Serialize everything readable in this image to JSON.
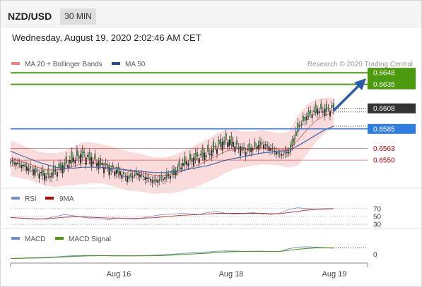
{
  "header": {
    "symbol": "NZD/USD",
    "interval": "30 MIN"
  },
  "datetime": "Wednesday, August 19, 2020 2:02:46 AM CET",
  "colors": {
    "bollinger": "#f08080",
    "ma50": "#1f4e8c",
    "resistance": "#4c9a0e",
    "pivot": "#2f7de1",
    "support": "#cc0000",
    "last": "#333333",
    "rsi": "#6f8fd6",
    "rsi_ma": "#cc0000",
    "macd": "#6f8fd6",
    "macd_signal": "#4c9a0e"
  },
  "chart_data": {
    "type": "candlestick",
    "title": "NZD/USD",
    "subtitle": "Wednesday, August 19, 2020 2:02:46 AM CET",
    "legend": [
      "MA 20 + Bollinger Bands",
      "MA 50"
    ],
    "copyright": "Research © 2020 Trading Central",
    "x_ticks": [
      "Aug 16",
      "Aug 18",
      "Aug 19"
    ],
    "levels": [
      {
        "label": "0.6648",
        "value": 0.6648,
        "kind": "resistance"
      },
      {
        "label": "0.6635",
        "value": 0.6635,
        "kind": "resistance"
      },
      {
        "label": "0.6608",
        "value": 0.6608,
        "kind": "last"
      },
      {
        "label": "0.6585",
        "value": 0.6585,
        "kind": "pivot"
      },
      {
        "label": "0.6563",
        "value": 0.6563,
        "kind": "support"
      },
      {
        "label": "0.6550",
        "value": 0.655,
        "kind": "support"
      }
    ],
    "price": [
      0.6548,
      0.6545,
      0.654,
      0.6536,
      0.6532,
      0.6538,
      0.6545,
      0.6552,
      0.6556,
      0.655,
      0.6545,
      0.654,
      0.6536,
      0.653,
      0.6535,
      0.653,
      0.6526,
      0.653,
      0.6535,
      0.6545,
      0.655,
      0.6555,
      0.6558,
      0.6566,
      0.6572,
      0.6566,
      0.656,
      0.6564,
      0.6568,
      0.6562,
      0.6556,
      0.656,
      0.6588,
      0.66,
      0.6606,
      0.6606,
      0.6608
    ],
    "ma50": [
      0.656,
      0.6556,
      0.6552,
      0.6548,
      0.6545,
      0.6542,
      0.6541,
      0.6541,
      0.6542,
      0.6542,
      0.6542,
      0.6541,
      0.654,
      0.6539,
      0.6538,
      0.6537,
      0.6536,
      0.6536,
      0.6537,
      0.6538,
      0.654,
      0.6542,
      0.6544,
      0.6547,
      0.655,
      0.6552,
      0.6554,
      0.6556,
      0.6558,
      0.6559,
      0.656,
      0.6561,
      0.6566,
      0.6572,
      0.6578,
      0.6584,
      0.6588
    ],
    "ma20": [
      0.6552,
      0.6549,
      0.6546,
      0.6542,
      0.6539,
      0.6539,
      0.654,
      0.6543,
      0.6546,
      0.6547,
      0.6546,
      0.6544,
      0.6541,
      0.6538,
      0.6537,
      0.6535,
      0.6533,
      0.6533,
      0.6534,
      0.6537,
      0.6541,
      0.6545,
      0.655,
      0.6555,
      0.656,
      0.6562,
      0.6562,
      0.6563,
      0.6564,
      0.6563,
      0.6562,
      0.6562,
      0.6572,
      0.6584,
      0.6594,
      0.66,
      0.6604
    ],
    "band_upper": [
      0.6572,
      0.6568,
      0.6564,
      0.656,
      0.6558,
      0.6558,
      0.656,
      0.6565,
      0.657,
      0.657,
      0.6568,
      0.6566,
      0.6563,
      0.656,
      0.6558,
      0.6556,
      0.6553,
      0.6553,
      0.6555,
      0.6559,
      0.6564,
      0.6569,
      0.6574,
      0.658,
      0.6584,
      0.6584,
      0.6582,
      0.6582,
      0.6584,
      0.6582,
      0.658,
      0.6582,
      0.66,
      0.6612,
      0.6618,
      0.662,
      0.662
    ],
    "band_lower": [
      0.6532,
      0.653,
      0.6528,
      0.6524,
      0.6521,
      0.652,
      0.6521,
      0.6522,
      0.6523,
      0.6524,
      0.6524,
      0.6522,
      0.6519,
      0.6516,
      0.6515,
      0.6514,
      0.6512,
      0.6513,
      0.6513,
      0.6515,
      0.6518,
      0.6521,
      0.6526,
      0.653,
      0.6536,
      0.654,
      0.6542,
      0.6544,
      0.6545,
      0.6545,
      0.6544,
      0.6542,
      0.6544,
      0.6556,
      0.657,
      0.658,
      0.6586
    ],
    "y_range": [
      0.652,
      0.666
    ],
    "rsi": {
      "legend": [
        "RSI",
        "9MA"
      ],
      "ticks": [
        "70",
        "50",
        "30"
      ],
      "values": [
        48,
        46,
        44,
        43,
        45,
        50,
        55,
        52,
        48,
        45,
        44,
        42,
        46,
        44,
        43,
        48,
        52,
        55,
        56,
        58,
        57,
        55,
        60,
        63,
        58,
        56,
        58,
        60,
        57,
        55,
        58,
        68,
        72,
        70,
        69,
        70,
        70
      ],
      "ma": [
        47,
        46,
        45,
        44,
        44,
        46,
        48,
        49,
        49,
        48,
        47,
        46,
        46,
        45,
        45,
        46,
        47,
        49,
        51,
        53,
        54,
        55,
        56,
        58,
        58,
        58,
        58,
        58,
        58,
        57,
        57,
        60,
        63,
        66,
        68,
        69,
        70
      ],
      "range": [
        25,
        75
      ]
    },
    "macd": {
      "legend": [
        "MACD",
        "MACD Signal"
      ],
      "ticks": [
        "0"
      ],
      "values": [
        -3.0,
        -2.8,
        -2.5,
        -2.4,
        -2.2,
        -1.8,
        -1.2,
        -0.8,
        -0.6,
        -0.6,
        -0.7,
        -0.9,
        -1.0,
        -1.0,
        -0.9,
        -0.8,
        -0.5,
        0.0,
        0.4,
        0.9,
        1.4,
        1.7,
        2.2,
        2.8,
        3.0,
        2.9,
        2.7,
        2.8,
        2.8,
        2.6,
        2.6,
        4.8,
        6.0,
        6.3,
        6.0,
        5.6,
        5.2
      ],
      "signal": [
        -3.0,
        -2.9,
        -2.7,
        -2.6,
        -2.4,
        -2.2,
        -1.8,
        -1.4,
        -1.1,
        -0.9,
        -0.8,
        -0.8,
        -0.9,
        -0.9,
        -0.9,
        -0.9,
        -0.8,
        -0.6,
        -0.3,
        0.1,
        0.5,
        0.9,
        1.3,
        1.8,
        2.2,
        2.5,
        2.6,
        2.7,
        2.7,
        2.7,
        2.7,
        3.5,
        4.3,
        5.0,
        5.4,
        5.5,
        5.4
      ],
      "range": [
        -5,
        8
      ]
    }
  }
}
